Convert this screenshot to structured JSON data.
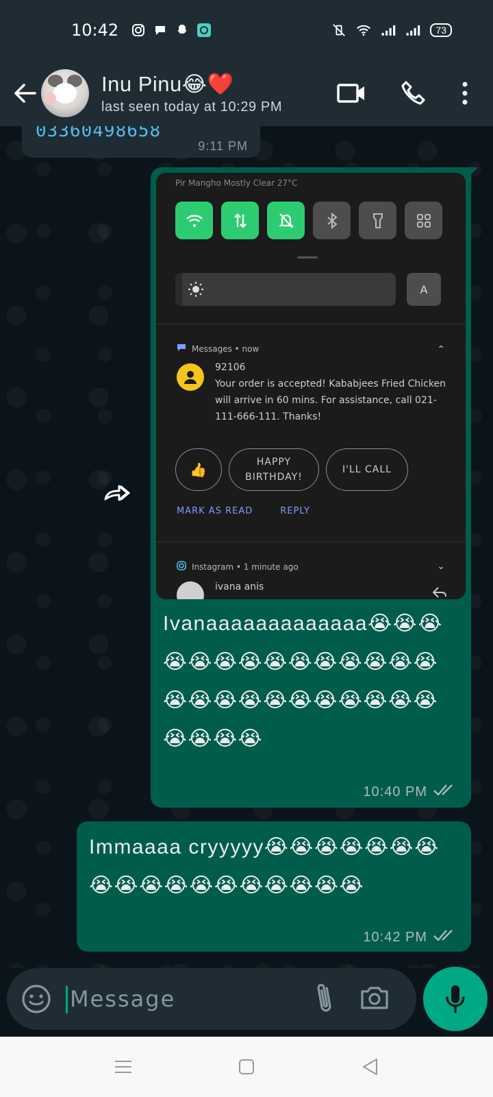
{
  "status_bar": {
    "time": "10:42",
    "battery": "73",
    "left_icons": [
      "instagram-icon",
      "chat-icon",
      "snapchat-icon",
      "app-icon"
    ],
    "right_icons": [
      "mute-vibrate-icon",
      "wifi-icon",
      "signal-icon",
      "signal-icon",
      "battery-icon"
    ]
  },
  "header": {
    "contact_name": "Inu Pinu😂❤️",
    "last_seen": "last seen today at 10:29 PM",
    "icons": [
      "back-arrow-icon",
      "video-call-icon",
      "phone-icon",
      "more-vert-icon"
    ]
  },
  "messages": {
    "incoming": {
      "text": "03360498658",
      "time": "9:11 PM"
    },
    "outgoing_1": {
      "screenshot": {
        "top_text": "Pir Mangho Mostly Clear 27°C",
        "auto_label": "A",
        "notif_app": "Messages • now",
        "notif_title": "92106",
        "notif_body": "Your order is accepted! Kababjees Fried Chicken will arrive in 60 mins. For assistance, call 021-111-666-111. Thanks!",
        "reply_1": "👍",
        "reply_2": "HAPPY BIRTHDAY!",
        "reply_3": "I'LL CALL",
        "action_1": "MARK AS READ",
        "action_2": "REPLY",
        "ig_app": "Instagram • 1 minute ago",
        "ig_name": "ivana anis"
      },
      "text": "Ivanaaaaaaaaaaaaa😭😭😭😭😭😭😭😭😭😭😭😭😭😭😭😭😭😭😭😭😭😭😭😭😭😭😭😭😭",
      "time": "10:40 PM",
      "status_icon": "double-check-icon"
    },
    "outgoing_2": {
      "text": "Immaaaa cryyyyy😭😭😭😭😭😭😭😭😭😭😭😭😭😭😭😭😭😭",
      "time": "10:42 PM",
      "status_icon": "double-check-icon"
    }
  },
  "input": {
    "placeholder": "Message",
    "icons": [
      "emoji-icon",
      "attach-icon",
      "camera-icon",
      "mic-icon"
    ]
  },
  "nav_bar": {
    "icons": [
      "menu-icon",
      "home-icon",
      "back-icon"
    ]
  },
  "colors": {
    "header_bg": "#1f2c34",
    "chat_bg": "#0b141a",
    "outgoing_bubble": "#005c4b",
    "incoming_bubble": "#1f2c34",
    "accent": "#00a884",
    "link": "#53bdeb"
  }
}
